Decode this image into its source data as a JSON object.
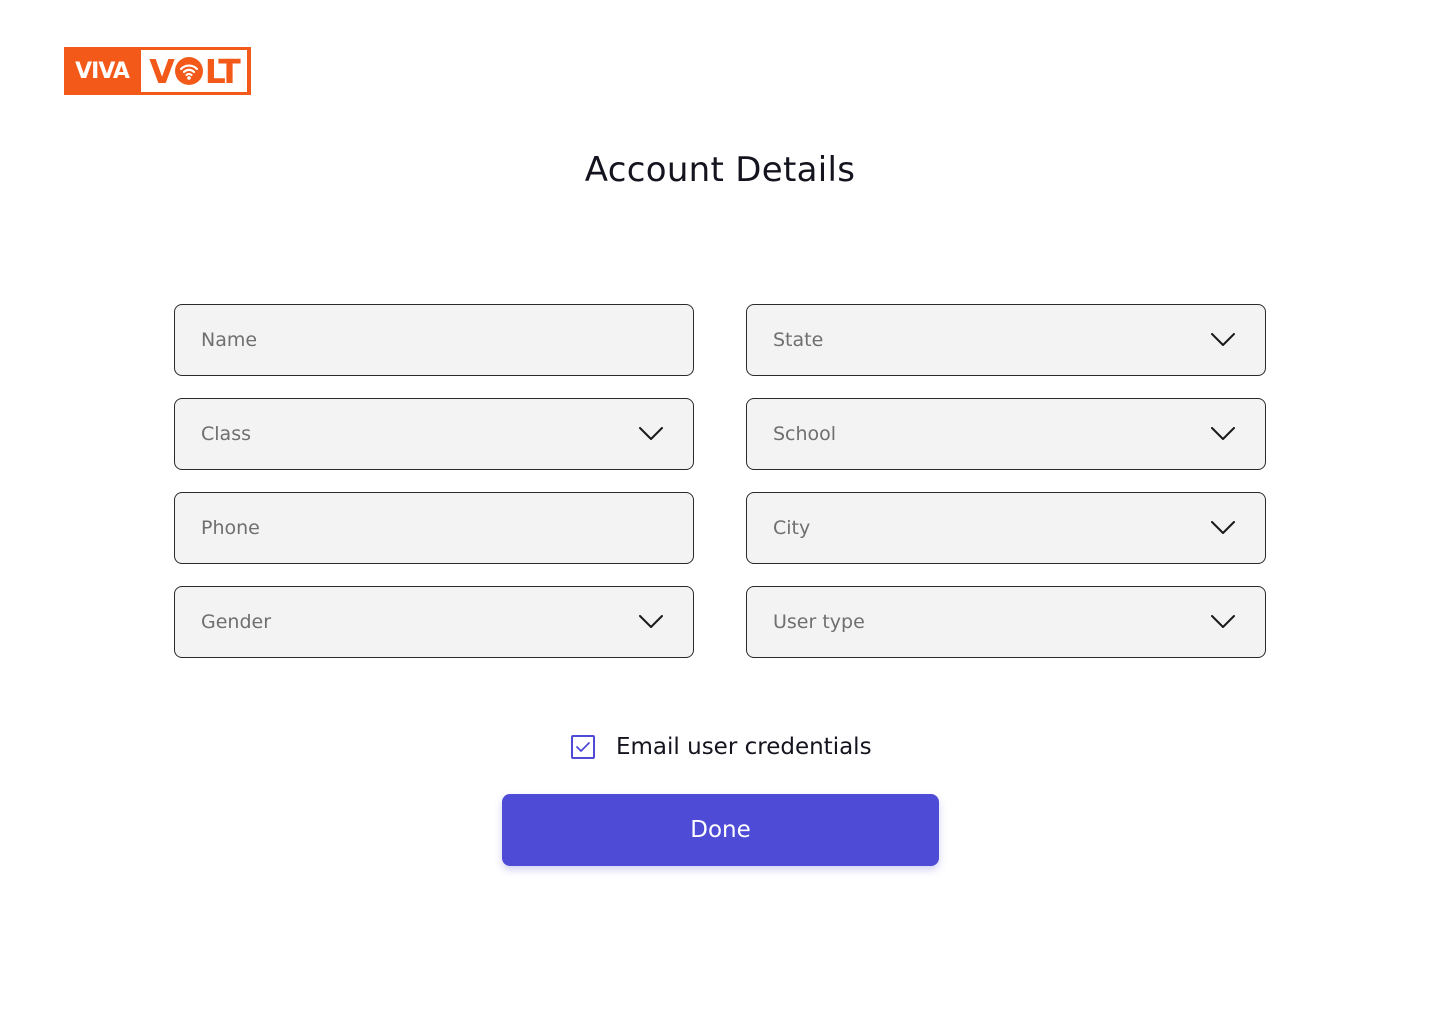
{
  "brand": {
    "logo_left": "VIVA",
    "logo_right_prefix": "V",
    "logo_right_suffix": "LT",
    "color": "#f35a1a"
  },
  "page": {
    "title": "Account Details"
  },
  "form": {
    "name": {
      "placeholder": "Name",
      "type": "text-input"
    },
    "state": {
      "label": "State",
      "type": "dropdown",
      "icon": "chevron-down-icon"
    },
    "class": {
      "label": "Class",
      "type": "dropdown",
      "icon": "chevron-down-icon"
    },
    "school": {
      "label": "School",
      "type": "dropdown",
      "icon": "chevron-down-icon"
    },
    "phone": {
      "placeholder": "Phone",
      "type": "text-input"
    },
    "city": {
      "label": "City",
      "type": "dropdown",
      "icon": "chevron-down-icon"
    },
    "gender": {
      "label": "Gender",
      "type": "dropdown",
      "icon": "chevron-down-icon"
    },
    "user_type": {
      "label": "User type",
      "type": "dropdown",
      "icon": "chevron-down-icon"
    }
  },
  "email_credentials": {
    "label": "Email user credentials",
    "checked": true,
    "icon": "checkmark-icon"
  },
  "actions": {
    "done_label": "Done",
    "accent": "#4e4bd6"
  }
}
